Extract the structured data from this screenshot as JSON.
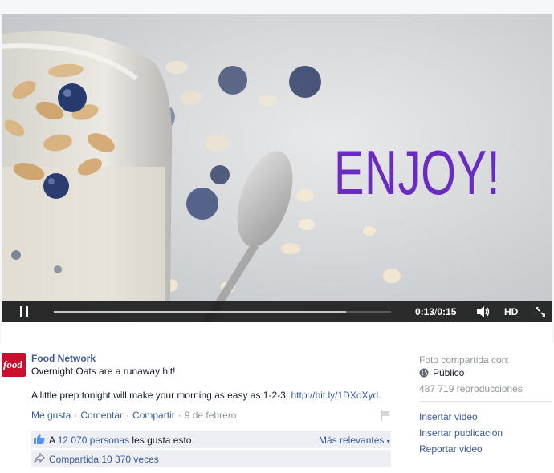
{
  "video": {
    "overlay_text": "ENJOY!",
    "current_time": "0:13",
    "separator": "/",
    "duration": "0:15",
    "progress_fraction": 0.867,
    "hd_label": "HD",
    "overlay_color": "#6a2cc0"
  },
  "icons": {
    "pause": "pause-icon",
    "volume": "volume-icon",
    "fullscreen": "fullscreen-icon",
    "flag": "flag-icon",
    "like": "thumbs-up-icon",
    "share": "share-icon",
    "globe": "globe-icon"
  },
  "post": {
    "author": "Food Network",
    "logo_text": "food",
    "caption_line1": "Overnight Oats are a runaway hit!",
    "caption_line2_prefix": "A little prep tonight will make your morning as easy as 1-2-3: ",
    "caption_link": "http://bit.ly/1DXoXyd",
    "caption_line2_suffix": ".",
    "actions": {
      "like": "Me gusta",
      "comment": "Comentar",
      "share": "Compartir",
      "date": "9 de febrero"
    },
    "likes": {
      "prefix": "A ",
      "count_link": "12 070 personas",
      "suffix": " les gusta esto.",
      "sort": "Más relevantes"
    },
    "shares": {
      "text": "Compartida 10 370 veces"
    }
  },
  "sidebar": {
    "shared_with_label": "Foto compartida con:",
    "audience": "Público",
    "views": "487 719 reproducciones",
    "links": [
      "Insertar video",
      "Insertar publicación",
      "Reportar video"
    ]
  },
  "colors": {
    "brand_link": "#3b5998",
    "muted": "#90949c",
    "food_logo": "#c8102e"
  }
}
